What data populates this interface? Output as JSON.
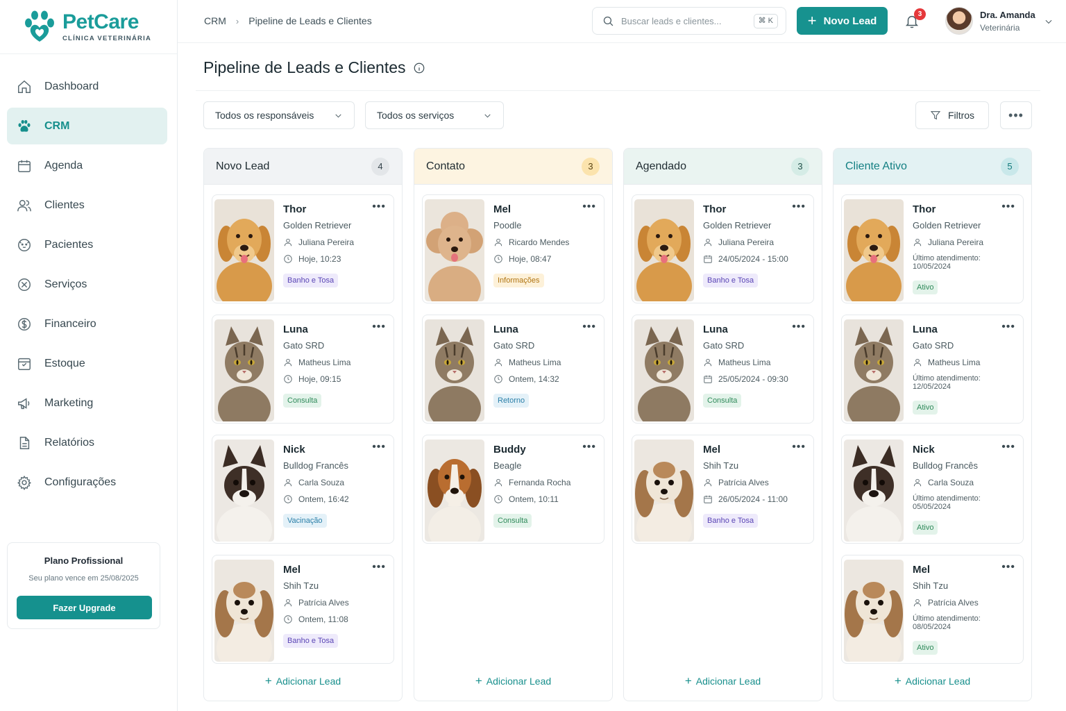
{
  "brand": {
    "name": "PetCare",
    "subtitle": "CLÍNICA VETERINÁRIA"
  },
  "sidebar": {
    "items": [
      {
        "label": "Dashboard",
        "icon": "home-icon",
        "active": false
      },
      {
        "label": "CRM",
        "icon": "paw-icon",
        "active": true
      },
      {
        "label": "Agenda",
        "icon": "calendar-icon",
        "active": false
      },
      {
        "label": "Clientes",
        "icon": "users-icon",
        "active": false
      },
      {
        "label": "Pacientes",
        "icon": "pet-face-icon",
        "active": false
      },
      {
        "label": "Serviços",
        "icon": "services-icon",
        "active": false
      },
      {
        "label": "Financeiro",
        "icon": "dollar-icon",
        "active": false
      },
      {
        "label": "Estoque",
        "icon": "box-icon",
        "active": false
      },
      {
        "label": "Marketing",
        "icon": "megaphone-icon",
        "active": false
      },
      {
        "label": "Relatórios",
        "icon": "report-icon",
        "active": false
      },
      {
        "label": "Configurações",
        "icon": "gear-icon",
        "active": false
      }
    ],
    "plan": {
      "title": "Plano Profissional",
      "expiry": "Seu plano vence em 25/08/2025",
      "button": "Fazer Upgrade"
    }
  },
  "header": {
    "breadcrumb": [
      "CRM",
      "Pipeline de Leads e Clientes"
    ],
    "search_placeholder": "Buscar leads e clientes...",
    "search_shortcut": "⌘ K",
    "new_lead_label": "Novo Lead",
    "notifications_count": "3",
    "user": {
      "name": "Dra. Amanda",
      "role": "Veterinária"
    }
  },
  "page": {
    "title": "Pipeline de Leads e Clientes",
    "filters": {
      "responsible": "Todos os responsáveis",
      "service": "Todos os serviços",
      "filters_label": "Filtros"
    },
    "add_lead_label": "Adicionar Lead"
  },
  "columns": [
    {
      "title": "Novo Lead",
      "count": "4",
      "cards": [
        {
          "name": "Thor",
          "breed": "Golden Retriever",
          "owner": "Juliana Pereira",
          "when": "Hoje, 10:23",
          "tag": "Banho e Tosa"
        },
        {
          "name": "Luna",
          "breed": "Gato SRD",
          "owner": "Matheus Lima",
          "when": "Hoje, 09:15",
          "tag": "Consulta"
        },
        {
          "name": "Nick",
          "breed": "Bulldog Francês",
          "owner": "Carla Souza",
          "when": "Ontem, 16:42",
          "tag": "Vacinação"
        },
        {
          "name": "Mel",
          "breed": "Shih Tzu",
          "owner": "Patrícia Alves",
          "when": "Ontem, 11:08",
          "tag": "Banho e Tosa"
        }
      ]
    },
    {
      "title": "Contato",
      "count": "3",
      "cards": [
        {
          "name": "Mel",
          "breed": "Poodle",
          "owner": "Ricardo Mendes",
          "when": "Hoje, 08:47",
          "tag": "Informações"
        },
        {
          "name": "Luna",
          "breed": "Gato SRD",
          "owner": "Matheus Lima",
          "when": "Ontem, 14:32",
          "tag": "Retorno"
        },
        {
          "name": "Buddy",
          "breed": "Beagle",
          "owner": "Fernanda Rocha",
          "when": "Ontem, 10:11",
          "tag": "Consulta"
        }
      ]
    },
    {
      "title": "Agendado",
      "count": "3",
      "cards": [
        {
          "name": "Thor",
          "breed": "Golden Retriever",
          "owner": "Juliana Pereira",
          "when": "24/05/2024 - 15:00",
          "tag": "Banho e Tosa"
        },
        {
          "name": "Luna",
          "breed": "Gato SRD",
          "owner": "Matheus Lima",
          "when": "25/05/2024 - 09:30",
          "tag": "Consulta"
        },
        {
          "name": "Mel",
          "breed": "Shih Tzu",
          "owner": "Patrícia Alves",
          "when": "26/05/2024 - 11:00",
          "tag": "Banho e Tosa"
        }
      ]
    },
    {
      "title": "Cliente Ativo",
      "count": "5",
      "cards": [
        {
          "name": "Thor",
          "breed": "Golden Retriever",
          "owner": "Juliana Pereira",
          "when": "Último atendimento: 10/05/2024",
          "tag": "Ativo"
        },
        {
          "name": "Luna",
          "breed": "Gato SRD",
          "owner": "Matheus Lima",
          "when": "Último atendimento: 12/05/2024",
          "tag": "Ativo"
        },
        {
          "name": "Nick",
          "breed": "Bulldog Francês",
          "owner": "Carla Souza",
          "when": "Último atendimento: 05/05/2024",
          "tag": "Ativo"
        },
        {
          "name": "Mel",
          "breed": "Shih Tzu",
          "owner": "Patrícia Alves",
          "when": "Último atendimento: 08/05/2024",
          "tag": "Ativo"
        }
      ]
    }
  ],
  "colors": {
    "accent": "#17928f",
    "novo_lead_header": "#f1f3f5",
    "contato_header": "#fdf4e1",
    "agendado_header": "#eaf4f1",
    "cliente_ativo_header": "#e3f2f3"
  }
}
